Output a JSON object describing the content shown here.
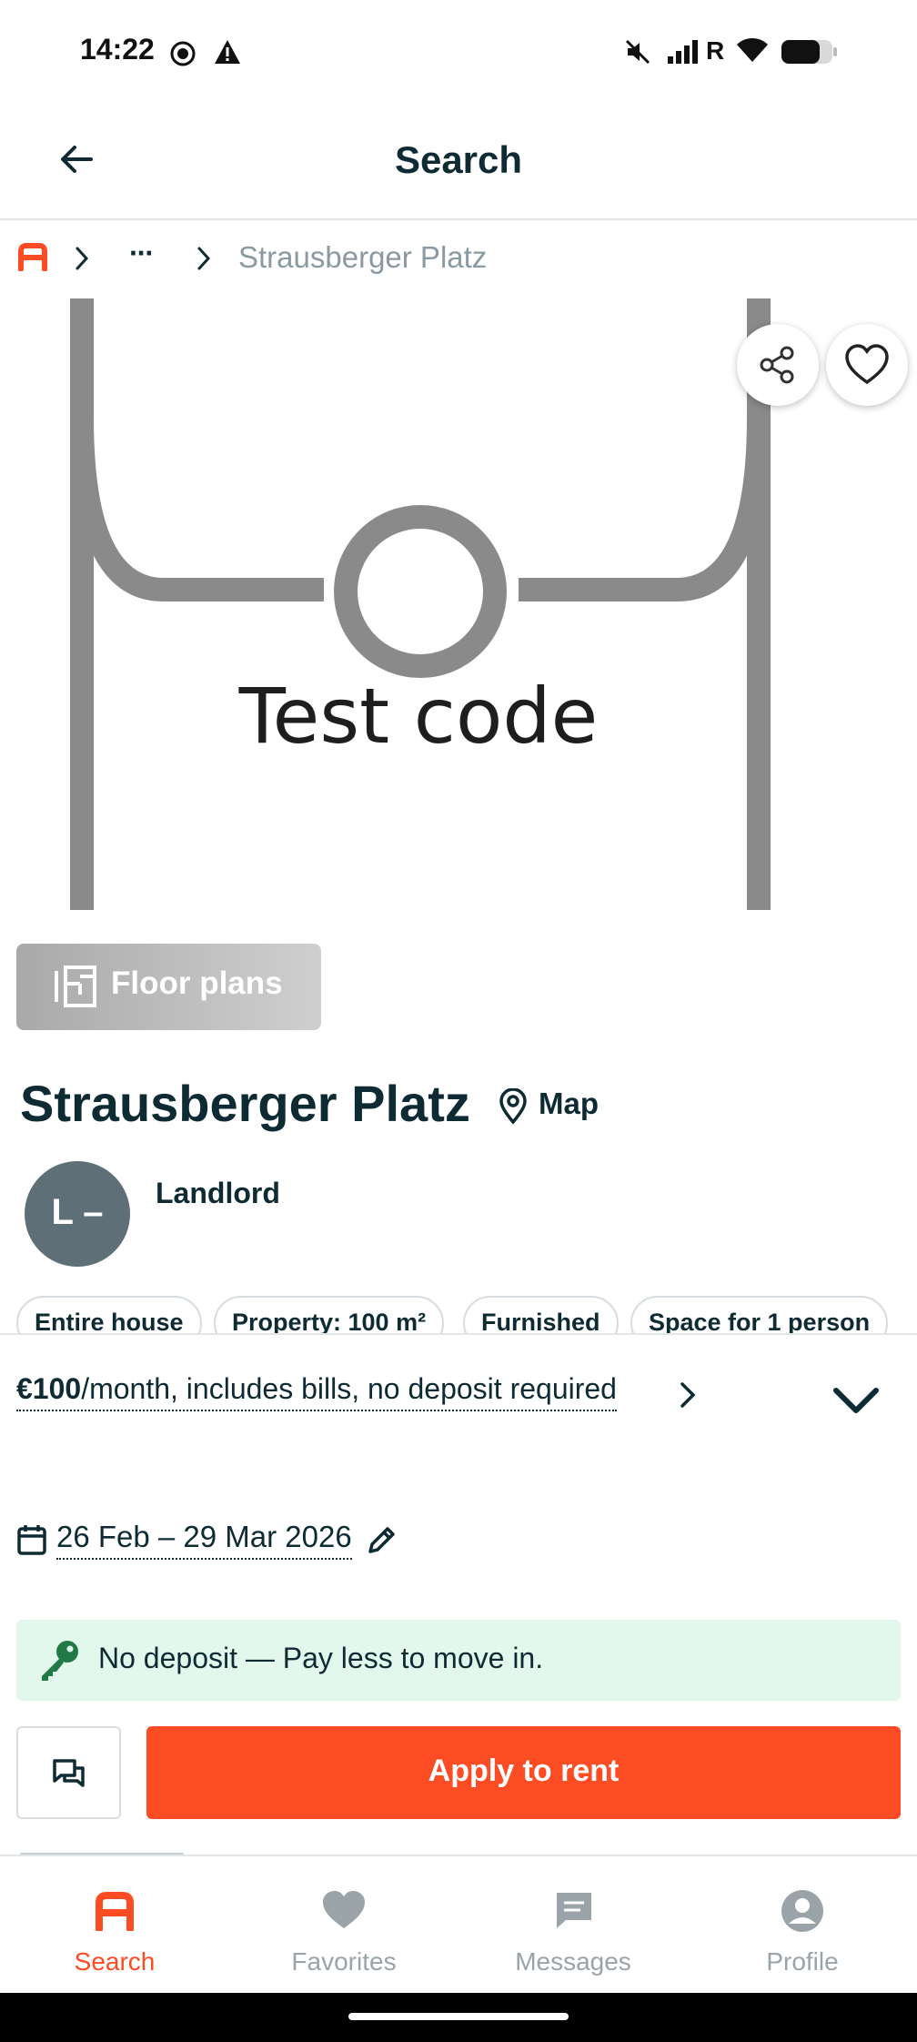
{
  "status_bar": {
    "time": "14:22",
    "carrier_indicator": "R"
  },
  "header": {
    "title": "Search"
  },
  "breadcrumb": {
    "ellipsis": "···",
    "current": "Strausberger Platz"
  },
  "photo": {
    "caption": "Test code"
  },
  "floor_plans": {
    "label": "Floor plans"
  },
  "listing": {
    "title": "Strausberger Platz",
    "map_label": "Map"
  },
  "landlord": {
    "initials": "L –",
    "label": "Landlord"
  },
  "chips": [
    "Entire house",
    "Property: 100 m²",
    "Furnished",
    "Space for 1 person"
  ],
  "price": {
    "amount": "€100",
    "details": "/month, includes bills, no deposit required"
  },
  "dates": {
    "range": "26 Feb – 29 Mar 2026"
  },
  "banner": {
    "text": "No deposit — Pay less to move in."
  },
  "actions": {
    "apply_label": "Apply to rent"
  },
  "tabs": [
    {
      "label": "Search",
      "icon": "brand-logo-icon",
      "active": true
    },
    {
      "label": "Favorites",
      "icon": "heart-icon",
      "active": false
    },
    {
      "label": "Messages",
      "icon": "message-icon",
      "active": false
    },
    {
      "label": "Profile",
      "icon": "profile-icon",
      "active": false
    }
  ],
  "colors": {
    "accent": "#fc4c23",
    "text": "#0e2a33",
    "muted": "#9aa3a8",
    "banner_bg": "#e3f8ec",
    "key_green": "#1f7a45"
  }
}
